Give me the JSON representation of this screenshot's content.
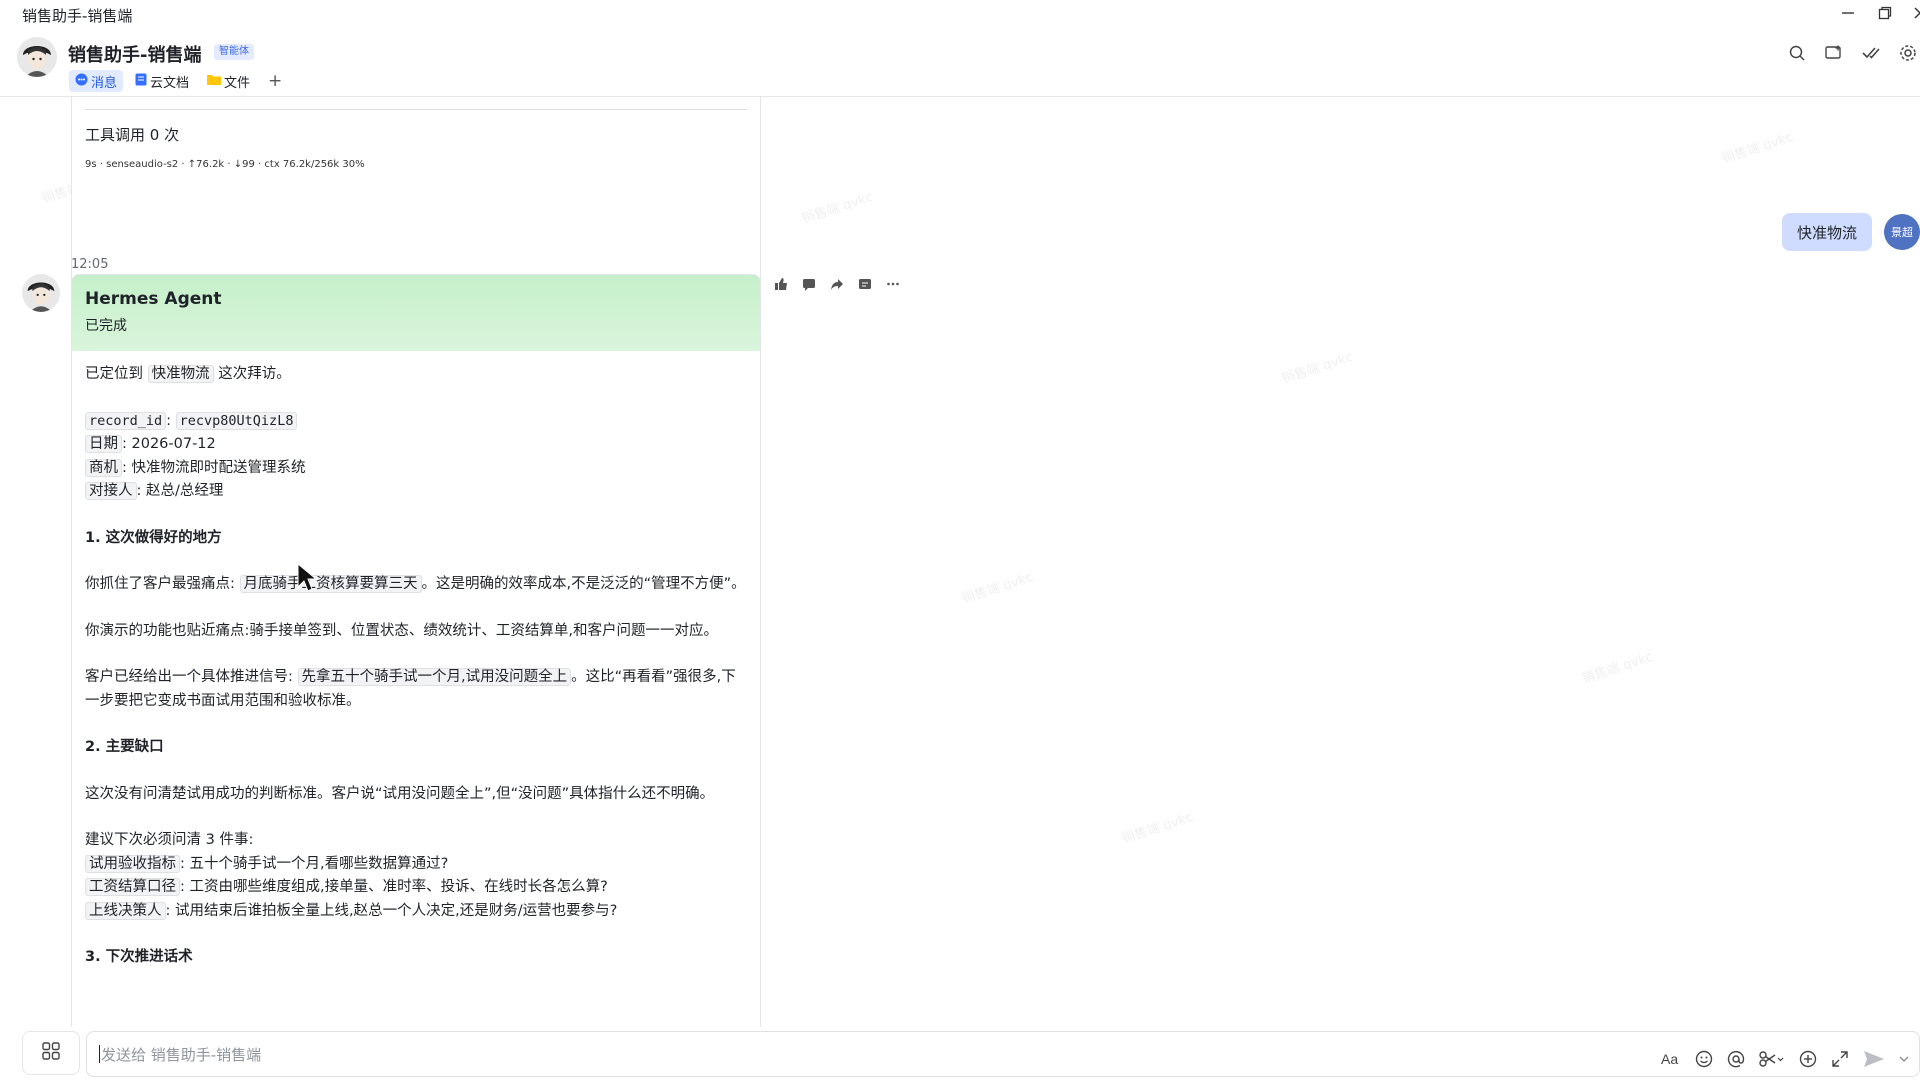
{
  "window": {
    "title": "销售助手-销售端"
  },
  "header": {
    "chat_title": "销售助手-销售端",
    "tag": "智能体",
    "tabs": [
      {
        "label": "消息",
        "active": true
      },
      {
        "label": "云文档",
        "active": false
      },
      {
        "label": "文件",
        "active": false
      }
    ],
    "add_tab": "+"
  },
  "watermark": "销售端 qvkc",
  "prev_card": {
    "tools": "工具调用 0 次",
    "meta": "9s · senseaudio-s2 · ↑76.2k · ↓99 · ctx 76.2k/256k 30%"
  },
  "user_msg": {
    "text": "快准物流",
    "avatar": "景超"
  },
  "time": "12:05",
  "agent": {
    "name": "Hermes Agent",
    "status": "已完成",
    "p1_a": "已定位到",
    "p1_code": "快准物流",
    "p1_b": "这次拜访。",
    "rec_key": "record_id",
    "rec_sep": ":",
    "rec_val": "recvp80UtQizL8",
    "date_key": "日期",
    "date_val": ": 2026-07-12",
    "opp_key": "商机",
    "opp_val": ": 快准物流即时配送管理系统",
    "contact_key": "对接人",
    "contact_val": ": 赵总/总经理",
    "h1": "1. 这次做得好的地方",
    "p2_a": "你抓住了客户最强痛点:",
    "p2_code": "月底骑手工资核算要算三天",
    "p2_b": "。这是明确的效率成本,不是泛泛的“管理不方便”。",
    "p3": "你演示的功能也贴近痛点:骑手接单签到、位置状态、绩效统计、工资结算单,和客户问题一一对应。",
    "p4_a": "客户已经给出一个具体推进信号:",
    "p4_code": "先拿五十个骑手试一个月,试用没问题全上",
    "p4_b": "。这比“再看看”强很多,下一步要把它变成书面试用范围和验收标准。",
    "h2": "2. 主要缺口",
    "p5": "这次没有问清楚试用成功的判断标准。客户说“试用没问题全上”,但“没问题”具体指什么还不明确。",
    "p6": "建议下次必须问清 3 件事:",
    "q1_key": "试用验收指标",
    "q1_val": ": 五十个骑手试一个月,看哪些数据算通过?",
    "q2_key": "工资结算口径",
    "q2_val": ": 工资由哪些维度组成,接单量、准时率、投诉、在线时长各怎么算?",
    "q3_key": "上线决策人",
    "q3_val": ": 试用结束后谁拍板全量上线,赵总一个人决定,还是财务/运营也要参与?",
    "h3": "3. 下次推进话术"
  },
  "input": {
    "placeholder": "发送给 销售助手-销售端"
  }
}
